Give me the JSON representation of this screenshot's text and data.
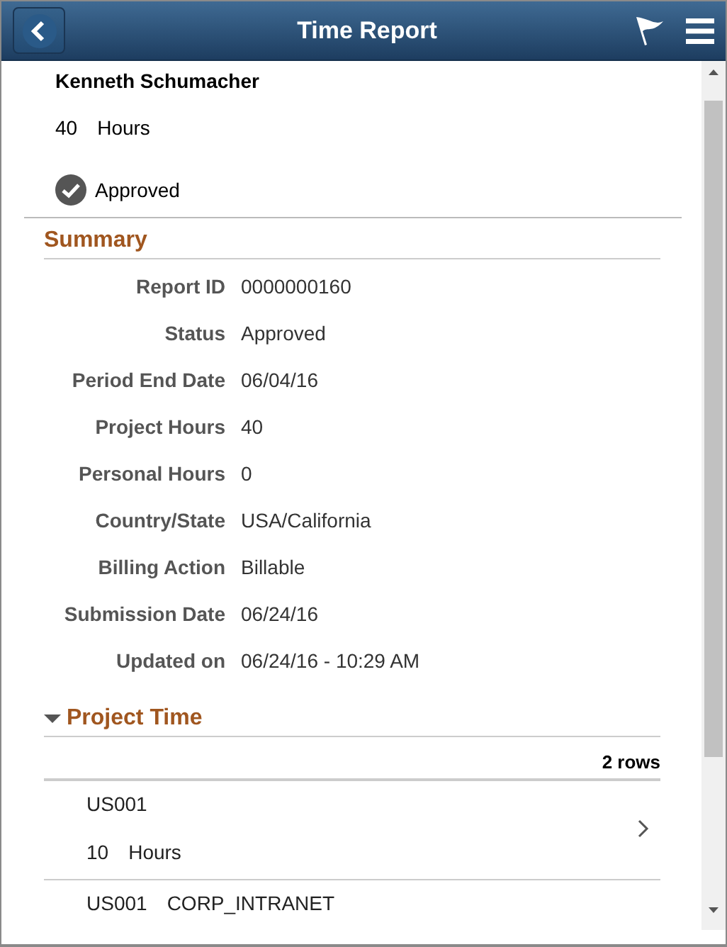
{
  "header": {
    "title": "Time Report"
  },
  "employee": {
    "name": "Kenneth Schumacher",
    "hours": "40",
    "hours_unit": "Hours",
    "status": "Approved"
  },
  "summary": {
    "title": "Summary",
    "fields": [
      {
        "label": "Report ID",
        "value": "0000000160"
      },
      {
        "label": "Status",
        "value": "Approved"
      },
      {
        "label": "Period End Date",
        "value": "06/04/16"
      },
      {
        "label": "Project Hours",
        "value": "40"
      },
      {
        "label": "Personal Hours",
        "value": "0"
      },
      {
        "label": "Country/State",
        "value": "USA/California"
      },
      {
        "label": "Billing Action",
        "value": "Billable"
      },
      {
        "label": "Submission Date",
        "value": "06/24/16"
      },
      {
        "label": "Updated on",
        "value": "06/24/16 - 10:29 AM"
      }
    ]
  },
  "project_time": {
    "title": "Project Time",
    "expanded": true,
    "row_count": "2 rows",
    "rows": [
      {
        "project": "US001",
        "hours": "10",
        "hours_unit": "Hours"
      },
      {
        "project": "US001",
        "activity": "CORP_INTRANET"
      }
    ]
  }
}
